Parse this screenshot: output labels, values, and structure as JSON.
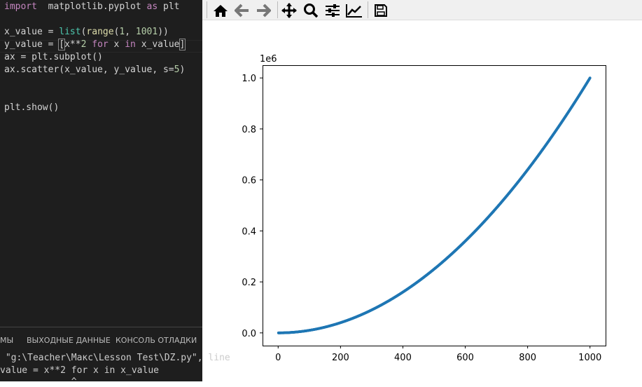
{
  "editor": {
    "lines": [
      {
        "parts": [
          [
            "kw",
            "import"
          ],
          [
            "",
            "  matplotlib.pyplot "
          ],
          [
            "kw",
            "as"
          ],
          [
            "",
            " plt"
          ]
        ]
      },
      {
        "parts": []
      },
      {
        "parts": [
          [
            "",
            "x_value = "
          ],
          [
            "fn",
            "list"
          ],
          [
            "",
            "("
          ],
          [
            "fn2",
            "range"
          ],
          [
            "",
            "("
          ],
          [
            "num",
            "1"
          ],
          [
            "",
            ", "
          ],
          [
            "num",
            "1001"
          ],
          [
            "",
            "))"
          ]
        ]
      },
      {
        "parts": [
          [
            "",
            "y_value = "
          ],
          [
            "br",
            "["
          ],
          [
            "",
            "x**"
          ],
          [
            "num",
            "2"
          ],
          [
            "kw",
            " for"
          ],
          [
            "",
            " x "
          ],
          [
            "kw",
            "in"
          ],
          [
            "",
            " x_value"
          ],
          [
            "br",
            "]"
          ]
        ]
      },
      {
        "parts": [
          [
            "",
            "ax = plt.subplot()"
          ]
        ]
      },
      {
        "parts": [
          [
            "",
            "ax.scatter(x_value, y_value, s="
          ],
          [
            "num",
            "5"
          ],
          [
            "",
            ")"
          ]
        ]
      },
      {
        "parts": []
      },
      {
        "parts": []
      },
      {
        "parts": [
          [
            "",
            "plt.show()"
          ]
        ]
      }
    ]
  },
  "panel": {
    "tabs": [
      "МЫ",
      "ВЫХОДНЫЕ ДАННЫЕ",
      "КОНСОЛЬ ОТЛАДКИ"
    ],
    "terminal": [
      " \"g:\\Teacher\\Макс\\Lesson Test\\DZ.py\", line",
      "value = x**2 for x in x_value",
      "             ^"
    ]
  },
  "toolbar": {
    "buttons": [
      "home-icon",
      "back-icon",
      "forward-icon",
      "pan-icon",
      "zoom-icon",
      "configure-subplots-icon",
      "edit-axis-icon",
      "save-icon"
    ]
  },
  "chart_data": {
    "type": "scatter",
    "x_start": 1,
    "x_end": 1000,
    "y_expression": "x**2",
    "marker_size": 5,
    "color": "#1f77b4",
    "xlim": [
      -50,
      1050
    ],
    "ylim": [
      -50000,
      1050000
    ],
    "xticks": [
      0,
      200,
      400,
      600,
      800,
      1000
    ],
    "xtick_labels": [
      "0",
      "200",
      "400",
      "600",
      "800",
      "1000"
    ],
    "yticks": [
      0,
      200000,
      400000,
      600000,
      800000,
      1000000
    ],
    "ytick_labels": [
      "0.0",
      "0.2",
      "0.4",
      "0.6",
      "0.8",
      "1.0"
    ],
    "offset_label": "1e6"
  }
}
